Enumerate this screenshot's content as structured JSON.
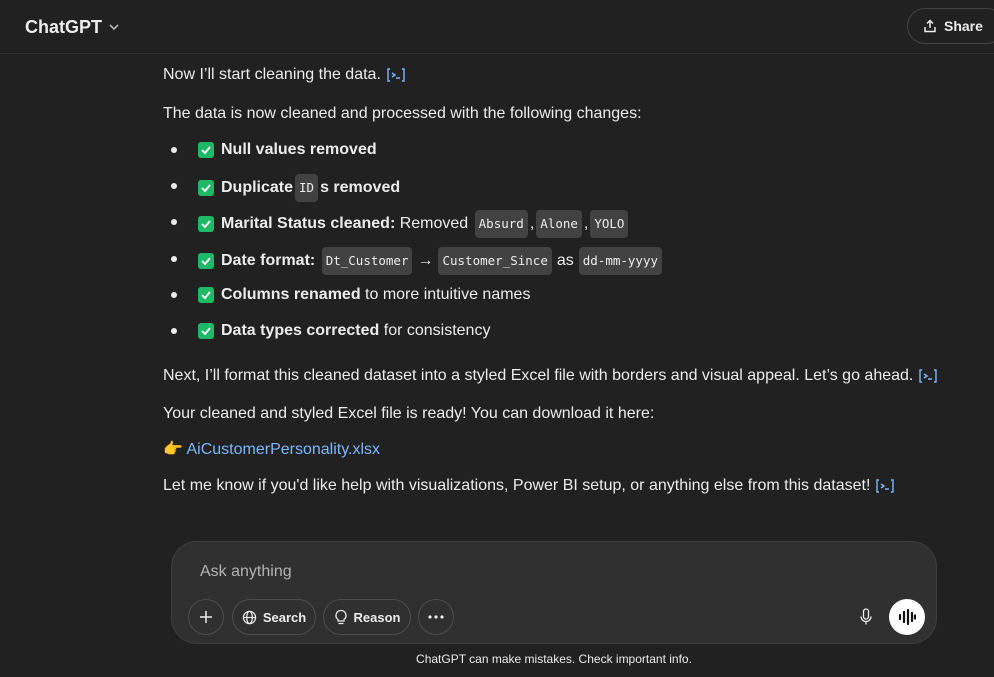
{
  "header": {
    "title": "ChatGPT",
    "share_label": "Share"
  },
  "message": {
    "intro": "Now I’ll start cleaning the data.",
    "summary": "The data is now cleaned and processed with the following changes:",
    "items": [
      {
        "bold": "Null values removed"
      },
      {
        "bold_pre": "Duplicate ",
        "code": "ID",
        "bold_post": "s removed"
      },
      {
        "bold": "Marital Status cleaned:",
        "text": " Removed ",
        "codes": [
          "Absurd",
          "Alone",
          "YOLO"
        ]
      },
      {
        "bold": "Date format:",
        "code1": "Dt_Customer",
        "arrow": "→",
        "code2": "Customer_Since",
        "as": "as",
        "code3": "dd-mm-yyyy"
      },
      {
        "bold": "Columns renamed",
        "text": " to more intuitive names"
      },
      {
        "bold": "Data types corrected",
        "text": " for consistency"
      }
    ],
    "next": "Next, I’ll format this cleaned dataset into a styled Excel file with borders and visual appeal. Let’s go ahead.",
    "ready": "Your cleaned and styled Excel file is ready! You can download it here:",
    "pointer": "👉",
    "file_link": "AiCustomerPersonality.xlsx",
    "closing": "Let me know if you'd like help with visualizations, Power BI setup, or anything else from this dataset!"
  },
  "composer": {
    "placeholder": "Ask anything",
    "search_label": "Search",
    "reason_label": "Reason"
  },
  "footer": "ChatGPT can make mistakes. Check important info.",
  "colors": {
    "check": "#1eb966",
    "link": "#7ab7ff",
    "background": "#212121"
  }
}
